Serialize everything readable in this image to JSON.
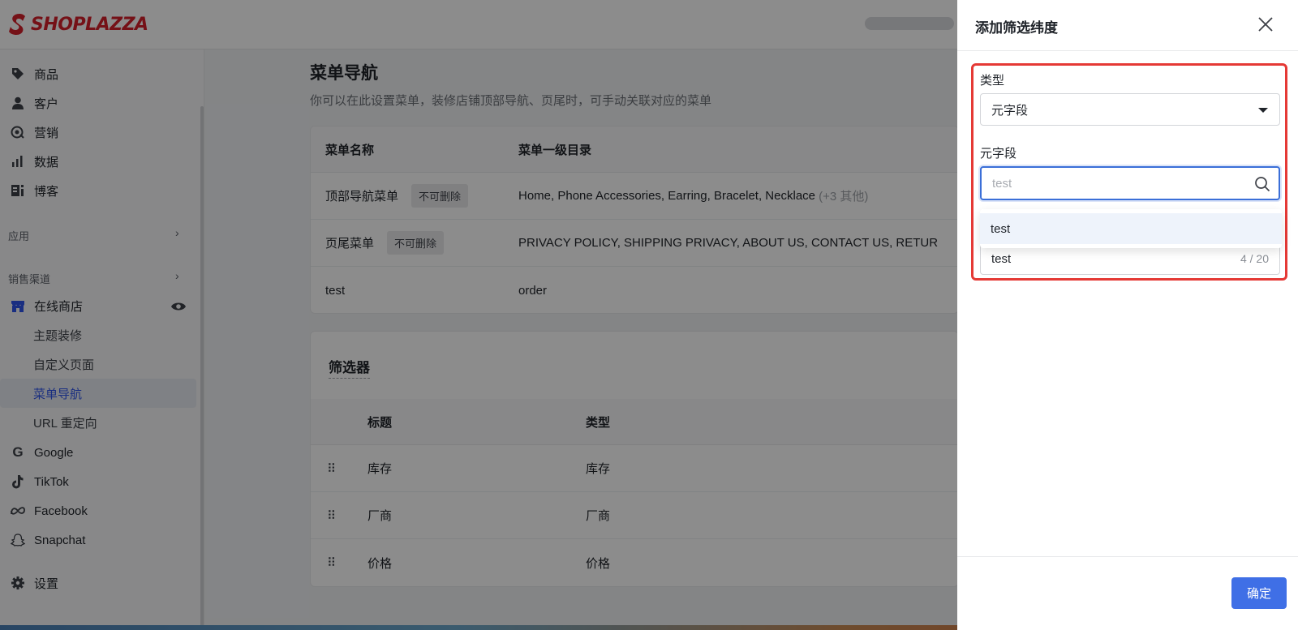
{
  "brand": {
    "name": "SHOPLAZZA",
    "color": "#d6202a"
  },
  "sidebar": {
    "items": [
      {
        "label": "商品",
        "icon": "tag-icon"
      },
      {
        "label": "客户",
        "icon": "user-icon"
      },
      {
        "label": "营销",
        "icon": "marketing-icon"
      },
      {
        "label": "数据",
        "icon": "bar-chart-icon"
      },
      {
        "label": "博客",
        "icon": "blog-icon"
      }
    ],
    "apps_label": "应用",
    "channels_label": "销售渠道",
    "online_store": {
      "label": "在线商店",
      "icon": "store-icon"
    },
    "online_store_sub": [
      {
        "label": "主题装修"
      },
      {
        "label": "自定义页面"
      },
      {
        "label": "菜单导航",
        "active": true
      },
      {
        "label": "URL 重定向"
      }
    ],
    "channels": [
      {
        "label": "Google",
        "icon": "google-icon"
      },
      {
        "label": "TikTok",
        "icon": "tiktok-icon"
      },
      {
        "label": "Facebook",
        "icon": "meta-icon"
      },
      {
        "label": "Snapchat",
        "icon": "snapchat-icon"
      }
    ],
    "settings_label": "设置"
  },
  "main": {
    "title": "菜单导航",
    "description": "你可以在此设置菜单，装修店铺顶部导航、页尾时，可手动关联对应的菜单",
    "menu_table": {
      "headers": [
        "菜单名称",
        "菜单一级目录"
      ],
      "rows": [
        {
          "name": "顶部导航菜单",
          "tag": "不可删除",
          "items": "Home, Phone Accessories, Earring, Bracelet, Necklace",
          "more": "(+3 其他)"
        },
        {
          "name": "页尾菜单",
          "tag": "不可删除",
          "items": "PRIVACY POLICY, SHIPPING PRIVACY, ABOUT US, CONTACT US, RETUR",
          "more": ""
        },
        {
          "name": "test",
          "tag": "",
          "items": "order",
          "more": ""
        }
      ]
    },
    "filter": {
      "title": "筛选器",
      "headers": [
        "标题",
        "类型"
      ],
      "rows": [
        {
          "title": "库存",
          "type": "库存"
        },
        {
          "title": "厂商",
          "type": "厂商"
        },
        {
          "title": "价格",
          "type": "价格"
        }
      ]
    }
  },
  "drawer": {
    "title": "添加筛选纬度",
    "type_label": "类型",
    "type_value": "元字段",
    "metafield_label": "元字段",
    "search_placeholder": "test",
    "dropdown_option": "test",
    "title_value": "test",
    "title_counter": "4 / 20",
    "confirm_label": "确定"
  },
  "colors": {
    "accent": "#3f6fe6",
    "highlight": "#e53935",
    "active_nav": "#2f54eb"
  }
}
